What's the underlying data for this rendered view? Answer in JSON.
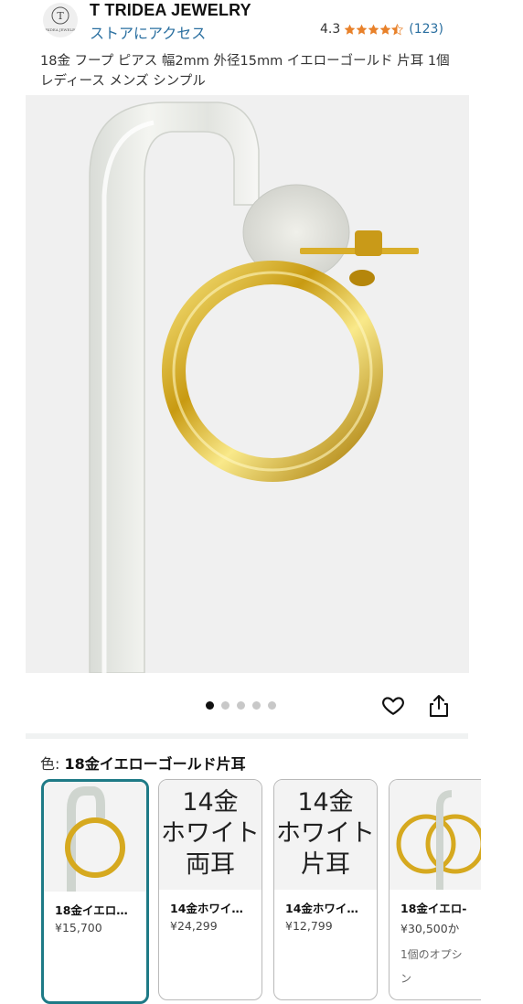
{
  "header": {
    "logo_text": "T",
    "logo_subtext": "TRIDEA JEWELRY",
    "brand": "T TRIDEA JEWELRY",
    "store_link": "ストアにアクセス",
    "rating": "4.3",
    "rating_stars": 4.3,
    "review_count": "(123)"
  },
  "product": {
    "title": "18金 フープ ピアス 幅2mm 外径15mm イエローゴールド 片耳 1個 レディース メンズ シンプル"
  },
  "gallery": {
    "image_count": 5,
    "active_index": 0
  },
  "variant": {
    "label": "色: ",
    "selected": "18金イエローゴールド片耳",
    "options": [
      {
        "name": "18金イエロ…",
        "price": "¥15,700",
        "thumb_text": ""
      },
      {
        "name": "14金ホワイ…",
        "price": "¥24,299",
        "thumb_text": "14金\nホワイト\n両耳"
      },
      {
        "name": "14金ホワイ…",
        "price": "¥12,799",
        "thumb_text": "14金\nホワイト\n片耳"
      },
      {
        "name": "18金イエロ-",
        "price": "¥30,500か",
        "note": "1個のオプシ\nン",
        "thumb_text": ""
      }
    ]
  },
  "colors": {
    "link": "#2a6fa0",
    "star": "#e8812a",
    "selected_border": "#1e7a86",
    "gold": "#d6a91f"
  }
}
